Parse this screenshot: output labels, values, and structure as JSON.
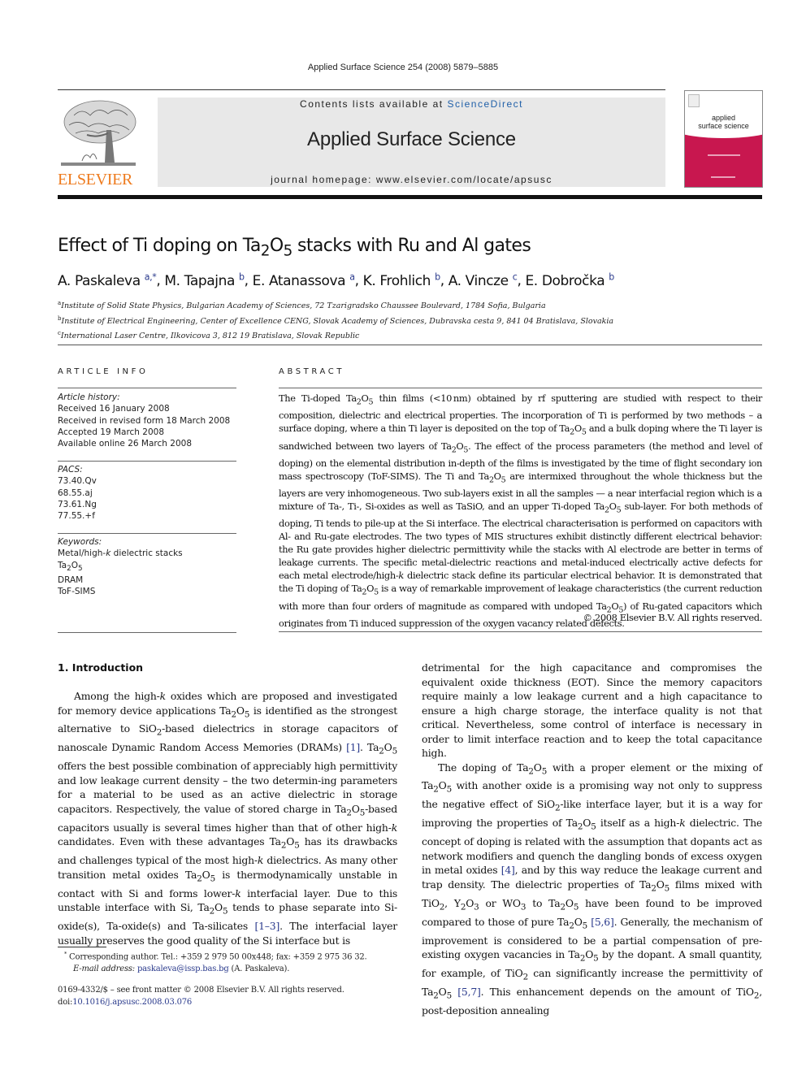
{
  "header": {
    "citation": "Applied Surface Science 254 (2008) 5879–5885",
    "publisher_logo_text": "ELSEVIER",
    "contents_prefix": "Contents lists available at ",
    "contents_link": "ScienceDirect",
    "journal_name": "Applied Surface Science",
    "homepage_prefix": "journal homepage: ",
    "homepage_url": "www.elsevier.com/locate/apsusc",
    "cover_title_line1": "applied",
    "cover_title_line2": "surface science"
  },
  "colors": {
    "elsevier_orange": "#ee7b1e",
    "link_blue": "#2a3a8c",
    "sciencedirect_blue": "#1f5fa8",
    "cover_magenta": "#c8174f",
    "header_gray": "#e8e8e8"
  },
  "article": {
    "title_pre": "Effect of Ti doping on Ta",
    "title_sub1": "2",
    "title_mid": "O",
    "title_sub2": "5",
    "title_post": " stacks with Ru and Al gates",
    "authors": [
      {
        "name": "A. Paskaleva",
        "aff": "a,*",
        "sep": ", "
      },
      {
        "name": "M. Tapajna",
        "aff": "b",
        "sep": ", "
      },
      {
        "name": "E. Atanassova",
        "aff": "a",
        "sep": ", "
      },
      {
        "name": "K. Frohlich",
        "aff": "b",
        "sep": ", "
      },
      {
        "name": "A. Vincze",
        "aff": "c",
        "sep": ", "
      },
      {
        "name": "E. Dobročka",
        "aff": "b",
        "sep": ""
      }
    ],
    "affiliations": [
      {
        "letter": "a",
        "text": "Institute of Solid State Physics, Bulgarian Academy of Sciences, 72 Tzarigradsko Chaussee Boulevard, 1784 Sofia, Bulgaria"
      },
      {
        "letter": "b",
        "text": "Institute of Electrical Engineering, Center of Excellence CENG, Slovak Academy of Sciences, Dubravska cesta 9, 841 04 Bratislava, Slovakia"
      },
      {
        "letter": "c",
        "text": "International Laser Centre, Ilkovicova 3, 812 19 Bratislava, Slovak Republic"
      }
    ]
  },
  "article_info": {
    "label": "ARTICLE INFO",
    "history_head": "Article history:",
    "history": [
      "Received 16 January 2008",
      "Received in revised form 18 March 2008",
      "Accepted 19 March 2008",
      "Available online 26 March 2008"
    ],
    "pacs_head": "PACS:",
    "pacs": [
      "73.40.Qv",
      "68.55.aj",
      "73.61.Ng",
      "77.55.+f"
    ],
    "keywords_head": "Keywords:",
    "keywords": [
      "Metal/high-k dielectric stacks",
      "Ta2O5",
      "DRAM",
      "ToF-SIMS"
    ]
  },
  "abstract": {
    "label": "ABSTRACT",
    "html": "The Ti-doped Ta<sub>2</sub>O<sub>5</sub> thin films (&lt;10&#8201;nm) obtained by rf sputtering are studied with respect to their composition, dielectric and electrical properties. The incorporation of Ti is performed by two methods – a surface doping, where a thin Ti layer is deposited on the top of Ta<sub>2</sub>O<sub>5</sub> and a bulk doping where the Ti layer is sandwiched between two layers of Ta<sub>2</sub>O<sub>5</sub>. The effect of the process parameters (the method and level of doping) on the elemental distribution in-depth of the films is investigated by the time of flight secondary ion mass spectroscopy (ToF-SIMS). The Ti and Ta<sub>2</sub>O<sub>5</sub> are intermixed throughout the whole thickness but the layers are very inhomogeneous. Two sub-layers exist in all the samples — a near interfacial region which is a mixture of Ta-, Ti-, Si-oxides as well as TaSiO, and an upper Ti-doped Ta<sub>2</sub>O<sub>5</sub> sub-layer. For both methods of doping, Ti tends to pile-up at the Si interface. The electrical characterisation is performed on capacitors with Al- and Ru-gate electrodes. The two types of MIS structures exhibit distinctly different electrical behavior: the Ru gate provides higher dielectric permittivity while the stacks with Al electrode are better in terms of leakage currents. The specific metal-dielectric reactions and metal-induced electrically active defects for each metal electrode/high-<i>k</i> dielectric stack define its particular electrical behavior. It is demonstrated that the Ti doping of Ta<sub>2</sub>O<sub>5</sub> is a way of remarkable improvement of leakage characteristics (the current reduction with more than four orders of magnitude as compared with undoped Ta<sub>2</sub>O<sub>5</sub>) of Ru-gated capacitors which originates from Ti induced suppression of the oxygen vacancy related defects.",
    "copyright": "© 2008 Elsevier B.V. All rights reserved."
  },
  "introduction": {
    "heading": "1.  Introduction",
    "left_html": "Among the high-<i>k</i> oxides which are proposed and investigated for memory device applications Ta<sub>2</sub>O<sub>5</sub> is identified as the strongest alternative to SiO<sub>2</sub>-based dielectrics in storage capacitors of nanoscale Dynamic Random Access Memories (DRAMs) <span class=\"cite\">[1]</span>. Ta<sub>2</sub>O<sub>5</sub> offers the best possible combination of appreciably high permittivity and low leakage current density – the two determin-ing parameters for a material to be used as an active dielectric in storage capacitors. Respectively, the value of stored charge in Ta<sub>2</sub>O<sub>5</sub>-based capacitors usually is several times higher than that of other high-<i>k</i> candidates. Even with these advantages Ta<sub>2</sub>O<sub>5</sub> has its drawbacks and challenges typical of the most high-<i>k</i> dielectrics. As many other transition metal oxides Ta<sub>2</sub>O<sub>5</sub> is thermodynamically unstable in contact with Si and forms lower-<i>k</i> interfacial layer. Due to this unstable interface with Si, Ta<sub>2</sub>O<sub>5</sub> tends to phase separate into Si-oxide(s), Ta-oxide(s) and Ta-silicates <span class=\"cite\">[1–3]</span>. The interfacial layer usually preserves the good quality of the Si interface but is",
    "right_p1_html": "detrimental for the high capacitance and compromises the equivalent oxide thickness (EOT). Since the memory capacitors require mainly a low leakage current and a high capacitance to ensure a high charge storage, the interface quality is not that critical. Nevertheless, some control of interface is necessary in order to limit interface reaction and to keep the total capacitance high.",
    "right_p2_html": "The doping of Ta<sub>2</sub>O<sub>5</sub> with a proper element or the mixing of Ta<sub>2</sub>O<sub>5</sub> with another oxide is a promising way not only to suppress the negative effect of SiO<sub>2</sub>-like interface layer, but it is a way for improving the properties of Ta<sub>2</sub>O<sub>5</sub> itself as a high-<i>k</i> dielectric. The concept of doping is related with the assumption that dopants act as network modifiers and quench the dangling bonds of excess oxygen in metal oxides <span class=\"cite\">[4]</span>, and by this way reduce the leakage current and trap density. The dielectric properties of Ta<sub>2</sub>O<sub>5</sub> films mixed with TiO<sub>2</sub>, Y<sub>2</sub>O<sub>3</sub> or WO<sub>3</sub> to Ta<sub>2</sub>O<sub>5</sub> have been found to be improved compared to those of pure Ta<sub>2</sub>O<sub>5</sub> <span class=\"cite\">[5,6]</span>. Generally, the mechanism of improvement is considered to be a partial compensation of pre-existing oxygen vacancies in Ta<sub>2</sub>O<sub>5</sub> by the dopant. A small quantity, for example, of TiO<sub>2</sub> can significantly increase the permittivity of Ta<sub>2</sub>O<sub>5</sub> <span class=\"cite\">[5,7]</span>. This enhancement depends on the amount of TiO<sub>2</sub>, post-deposition annealing"
  },
  "footnote": {
    "marker": "*",
    "corresponding": "Corresponding author. Tel.: +359 2 979 50 00x448; fax: +359 2 975 36 32.",
    "email_label": "E-mail address:",
    "email": "paskaleva@issp.bas.bg",
    "email_owner": "(A. Paskaleva)."
  },
  "issn": {
    "line": "0169-4332/$ – see front matter © 2008 Elsevier B.V. All rights reserved.",
    "doi_prefix": "doi:",
    "doi": "10.1016/j.apsusc.2008.03.076"
  }
}
